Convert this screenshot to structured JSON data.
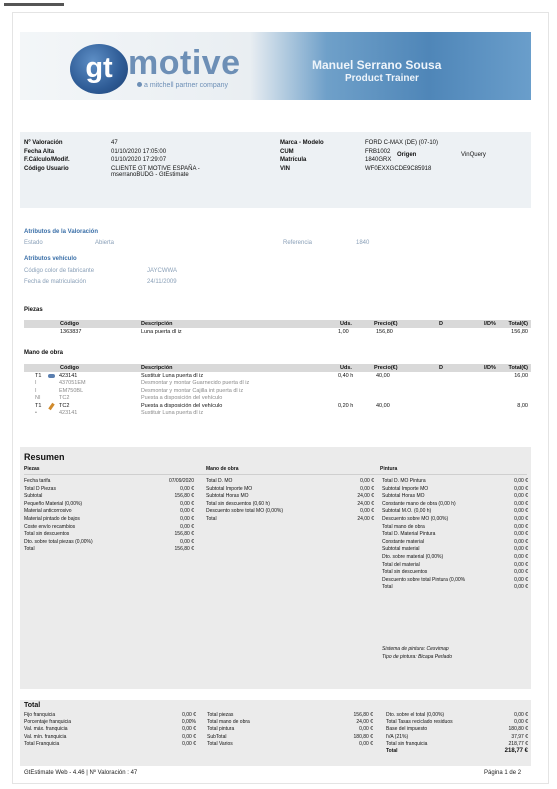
{
  "banner": {
    "logo_mark": "gt",
    "logo_word": "motive",
    "logo_sub": "a mitchell partner company",
    "trainer_name": "Manuel Serrano Sousa",
    "trainer_role": "Product Trainer"
  },
  "info": {
    "left": [
      {
        "label": "Nº Valoración",
        "value": "47"
      },
      {
        "label": "Fecha Alta",
        "value": "01/10/2020 17:05:00"
      },
      {
        "label": "F.Cálculo/Modif.",
        "value": "01/10/2020 17:29:07"
      },
      {
        "label": "Código Usuario",
        "value": "CLIENTE GT MOTIVE ESPAÑA -"
      },
      {
        "label": "",
        "value": "mserranoBUDG - GtEstimate"
      }
    ],
    "right": [
      {
        "label": "Marca - Modelo",
        "value": "FORD C-MAX (DE) (07-10)"
      },
      {
        "label": "CUM",
        "value": "FRB1002"
      },
      {
        "label": "Matrícula",
        "value": "1840GRX"
      },
      {
        "label": "VIN",
        "value": "WF0EXXGCDE9C85918"
      }
    ],
    "origen_label": "Origen",
    "origen_value": "VinQuery"
  },
  "atributos": {
    "title": "Atributos de la Valoración",
    "estado_label": "Estado",
    "estado_value": "Abierta",
    "ref_label": "Referencia",
    "ref_value": "1840",
    "veh_title": "Atributos vehículo",
    "color_label": "Código color de fabricante",
    "color_value": "JAYCWWA",
    "fecha_label": "Fecha de matriculación",
    "fecha_value": "24/11/2009"
  },
  "piezas": {
    "title": "Piezas",
    "headers": [
      "Código",
      "Descripción",
      "Uds.",
      "Precio(€)",
      "D",
      "I/D%",
      "Total(€)"
    ],
    "rows": [
      {
        "codigo": "1363837",
        "desc": "Luna puerta dl iz",
        "uds": "1,00",
        "precio": "156,80",
        "total": "156,80"
      }
    ]
  },
  "mano": {
    "title": "Mano de obra",
    "headers": [
      "Código",
      "Descripción",
      "Uds.",
      "Precio(€)",
      "D",
      "I/D%",
      "Total(€)"
    ],
    "rows": [
      {
        "prefix": "T1",
        "codigo": "423141",
        "desc": "Sustituir Luna puerta dl iz",
        "uds": "0,40 h",
        "precio": "40,00",
        "total": "16,00",
        "sub": false
      },
      {
        "prefix": "I",
        "codigo": "437051EM",
        "desc": "Desmontar y montar Guarnecido puerta dl iz",
        "uds": "",
        "precio": "",
        "total": "",
        "sub": true
      },
      {
        "prefix": "I",
        "codigo": "EM750BL",
        "desc": "Desmontar y montar Cajilla int puerta dl iz",
        "uds": "",
        "precio": "",
        "total": "",
        "sub": true
      },
      {
        "prefix": "NI",
        "codigo": "TC2",
        "desc": "Puesta a disposición del vehículo",
        "uds": "",
        "precio": "",
        "total": "",
        "sub": true
      },
      {
        "prefix": "T1",
        "codigo": "TC2",
        "desc": "Puesta a disposición del vehículo",
        "uds": "0,20 h",
        "precio": "40,00",
        "total": "8,00",
        "sub": false
      },
      {
        "prefix": "•",
        "codigo": "423141",
        "desc": "Sustituir Luna puerta dl iz",
        "uds": "",
        "precio": "",
        "total": "",
        "sub": true
      }
    ]
  },
  "resumen": {
    "title": "Resumen",
    "col1_title": "Piezas",
    "col2_title": "Mano de obra",
    "col3_title": "Pintura",
    "col1": [
      [
        "Fecha tarifa",
        "07/09/2020"
      ],
      [
        "Total D Piezas",
        "0,00 €"
      ],
      [
        "Subtotal",
        "156,80 €"
      ],
      [
        "Pequeño Material (0,00%)",
        "0,00 €"
      ],
      [
        "Material anticorrosivo",
        "0,00 €"
      ],
      [
        "Material pintado de bajos",
        "0,00 €"
      ],
      [
        "Coste envío recambios",
        "0,00 €"
      ],
      [
        "Total sin descuentos",
        "156,80 €"
      ],
      [
        "Dto. sobre total piezas (0,00%)",
        "0,00 €"
      ],
      [
        "Total",
        "156,80 €"
      ]
    ],
    "col2": [
      [
        "Total D. MO",
        "0,00 €"
      ],
      [
        "Subtotal Importe MO",
        "0,00 €"
      ],
      [
        "Subtotal Horas MO",
        "24,00 €"
      ],
      [
        "Total sin descuentos (0,60 h)",
        "24,00 €"
      ],
      [
        "Descuento sobre total MO (0,00%)",
        "0,00 €"
      ],
      [
        "Total",
        "24,00 €"
      ]
    ],
    "col3": [
      [
        "Total D. MO Pintura",
        "0,00 €"
      ],
      [
        "Subtotal Importe MO",
        "0,00 €"
      ],
      [
        "Subtotal Horas MO",
        "0,00 €"
      ],
      [
        "Constante mano de obra (0,00 h)",
        "0,00 €"
      ],
      [
        "Subtotal M.O. (0,00 h)",
        "0,00 €"
      ],
      [
        "Descuento sobre MO (0,00%)",
        "0,00 €"
      ],
      [
        "Total mano de obra",
        "0,00 €"
      ],
      [
        "Total D. Material Pintura",
        "0,00 €"
      ],
      [
        "Constante material",
        "0,00 €"
      ],
      [
        "Subtotal material",
        "0,00 €"
      ],
      [
        "Dto. sobre material (0,00%)",
        "0,00 €"
      ],
      [
        "Total del material",
        "0,00 €"
      ],
      [
        "Total sin descuentos",
        "0,00 €"
      ],
      [
        "Descuento sobre total Pintura (0,00%",
        "0,00 €"
      ],
      [
        "Total",
        "0,00 €"
      ]
    ],
    "sistema": "Sistema de pintura: Cesvimap",
    "tipo": "Tipo de pintura: Bicapa Perlado"
  },
  "total": {
    "title": "Total",
    "col1": [
      [
        "Fijo franquicia",
        "0,00 €"
      ],
      [
        "Porcentaje franquicia",
        "0,00%"
      ],
      [
        "Val. máx. franquicia",
        "0,00 €"
      ],
      [
        "Val. mín. franquicia",
        "0,00 €"
      ],
      [
        "Total Franquicia",
        "0,00 €"
      ]
    ],
    "col2": [
      [
        "Total piezas",
        "156,80 €"
      ],
      [
        "Total mano de obra",
        "24,00 €"
      ],
      [
        "Total pintura",
        "0,00 €"
      ],
      [
        "SubTotal",
        "180,80 €"
      ],
      [
        "Total Varios",
        "0,00 €"
      ]
    ],
    "col3": [
      [
        "Dto. sobre el total (0,00%)",
        "0,00 €"
      ],
      [
        "Total Tasas reciclado residuos",
        "0,00 €"
      ],
      [
        "Base del impuesto",
        "180,80 €"
      ],
      [
        "IVA (21%)",
        "37,97 €"
      ],
      [
        "Total sin franquicia",
        "218,77 €"
      ],
      [
        "Total",
        "218,77 €"
      ]
    ]
  },
  "footer": {
    "left": "GtEstimate Web - 4.46 | Nº Valoración : 47",
    "right": "Página 1 de 2"
  }
}
